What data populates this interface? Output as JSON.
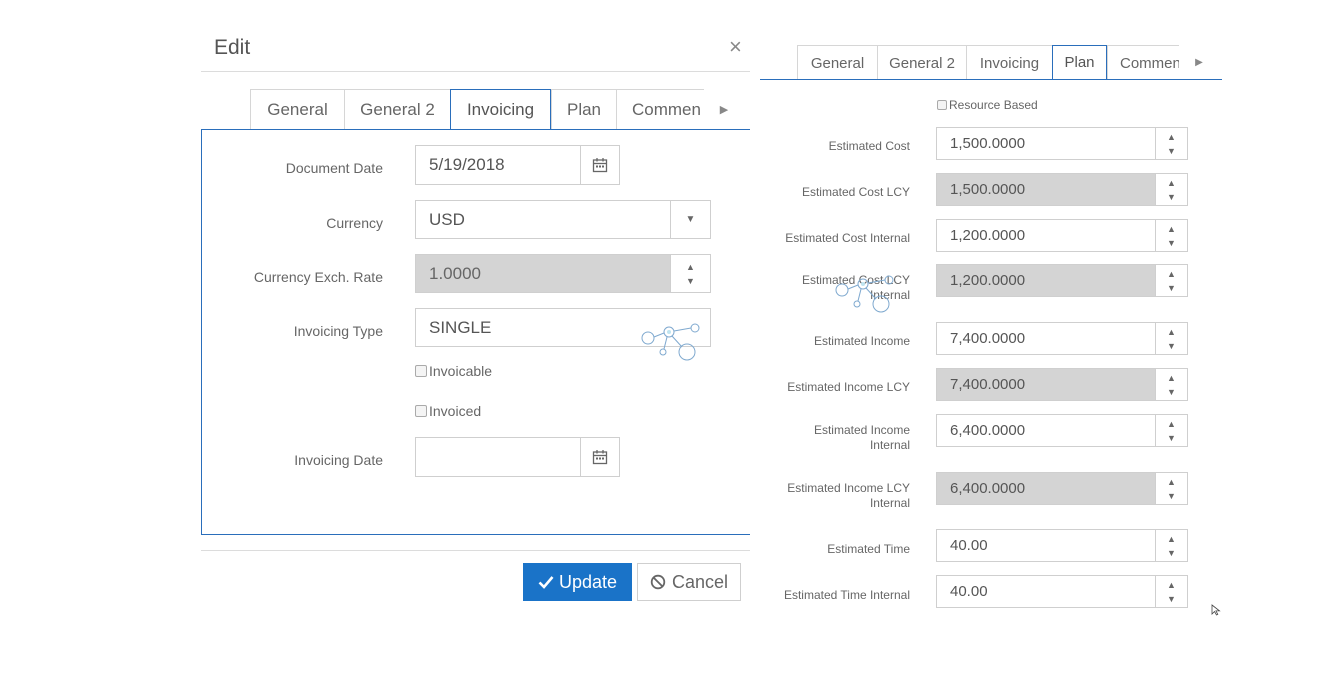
{
  "dialog": {
    "title": "Edit",
    "close": "×",
    "tabs": [
      "General",
      "General 2",
      "Invoicing",
      "Plan",
      "Commen"
    ],
    "active_tab": "Invoicing",
    "fields": {
      "document_date": {
        "label": "Document Date",
        "value": "5/19/2018"
      },
      "currency": {
        "label": "Currency",
        "value": "USD"
      },
      "currency_rate": {
        "label": "Currency Exch. Rate",
        "value": "1.0000"
      },
      "invoicing_type": {
        "label": "Invoicing Type",
        "value": "SINGLE"
      },
      "invoicable": {
        "label": "Invoicable",
        "checked": false
      },
      "invoiced": {
        "label": "Invoiced",
        "checked": false
      },
      "invoicing_date": {
        "label": "Invoicing Date",
        "value": ""
      }
    },
    "buttons": {
      "update": "Update",
      "cancel": "Cancel"
    }
  },
  "plan": {
    "tabs": [
      "General",
      "General 2",
      "Invoicing",
      "Plan",
      "Commen"
    ],
    "active_tab": "Plan",
    "resource_based": {
      "label": "Resource Based",
      "checked": false
    },
    "fields": [
      {
        "label": "Estimated Cost",
        "value": "1,500.0000",
        "disabled": false
      },
      {
        "label": "Estimated Cost LCY",
        "value": "1,500.0000",
        "disabled": true
      },
      {
        "label": "Estimated Cost Internal",
        "value": "1,200.0000",
        "disabled": false
      },
      {
        "label1": "Estimated Cost LCY",
        "label2": "Internal",
        "value": "1,200.0000",
        "disabled": true
      },
      {
        "label": "Estimated Income",
        "value": "7,400.0000",
        "disabled": false
      },
      {
        "label": "Estimated Income LCY",
        "value": "7,400.0000",
        "disabled": true
      },
      {
        "label1": "Estimated Income",
        "label2": "Internal",
        "value": "6,400.0000",
        "disabled": false
      },
      {
        "label1": "Estimated Income LCY",
        "label2": "Internal",
        "value": "6,400.0000",
        "disabled": true
      },
      {
        "label": "Estimated Time",
        "value": "40.00",
        "disabled": false
      },
      {
        "label": "Estimated Time Internal",
        "value": "40.00",
        "disabled": false
      }
    ]
  },
  "colors": {
    "accent": "#1a73c8",
    "border_active": "#2a6ebb",
    "disabled_bg": "#d4d4d4"
  }
}
